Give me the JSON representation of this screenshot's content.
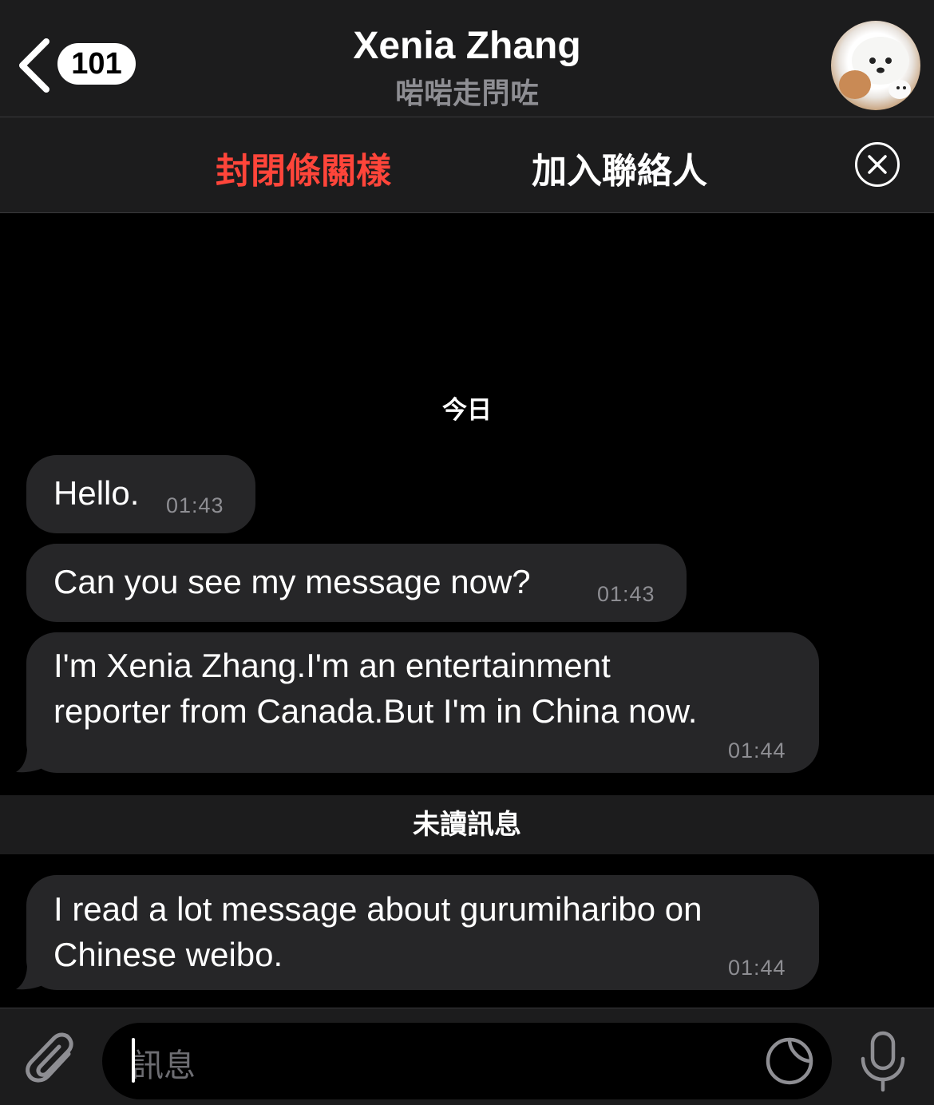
{
  "header": {
    "back_badge": "101",
    "title": "Xenia Zhang",
    "subtitle": "啱啱走閅咗"
  },
  "actions": {
    "block_label": "封閉條關樣",
    "add_contact_label": "加入聯絡人"
  },
  "chat": {
    "date_label": "今日",
    "messages": [
      {
        "text": "Hello.",
        "time": "01:43"
      },
      {
        "text": "Can you see my message now?",
        "time": "01:43"
      },
      {
        "line1": "I'm Xenia Zhang.I'm an entertainment",
        "line2": "reporter from Canada.But I'm in China now.",
        "time": "01:44"
      }
    ],
    "unread_label": "未讀訊息",
    "unread_messages": [
      {
        "line1": "I read a lot message about gurumiharibo on",
        "line2": "Chinese weibo.",
        "time": "01:44"
      }
    ]
  },
  "composer": {
    "placeholder": "訊息"
  },
  "colors": {
    "background": "#000000",
    "bar": "#1c1c1d",
    "bubble": "#262628",
    "danger": "#ff453a",
    "secondary": "#8e8e93"
  },
  "icons": [
    "chevron-left-icon",
    "close-circle-icon",
    "paperclip-icon",
    "sticker-icon",
    "microphone-icon"
  ]
}
